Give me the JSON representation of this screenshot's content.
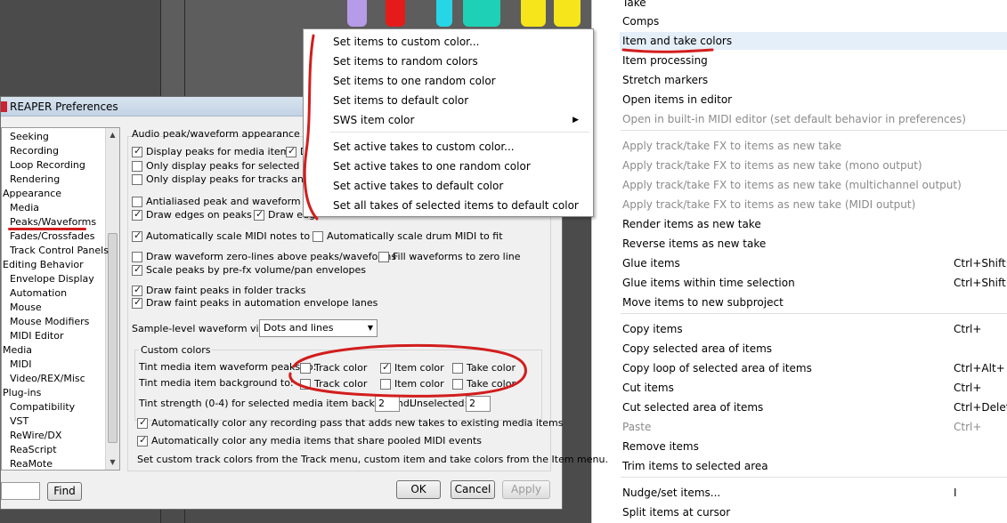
{
  "item_menu": {
    "items": [
      {
        "label": "Take",
        "disabled": false
      },
      {
        "label": "Comps",
        "disabled": false
      },
      {
        "label": "Item and take colors",
        "disabled": false,
        "highlighted": true
      },
      {
        "label": "Item processing",
        "disabled": false
      },
      {
        "label": "Stretch markers",
        "disabled": false
      },
      {
        "label": "Open items in editor",
        "disabled": false
      },
      {
        "label": "Open in built-in MIDI editor (set default behavior in preferences)",
        "disabled": true
      },
      {
        "label": "Apply track/take FX to items as new take",
        "disabled": true
      },
      {
        "label": "Apply track/take FX to items as new take (mono output)",
        "disabled": true
      },
      {
        "label": "Apply track/take FX to items as new take (multichannel output)",
        "disabled": true
      },
      {
        "label": "Apply track/take FX to items as new take (MIDI output)",
        "disabled": true
      },
      {
        "label": "Render items as new take",
        "disabled": false
      },
      {
        "label": "Reverse items as new take",
        "disabled": false
      },
      {
        "label": "Glue items",
        "disabled": false,
        "shortcut": "Ctrl+Shift+I"
      },
      {
        "label": "Glue items within time selection",
        "disabled": false,
        "shortcut": "Ctrl+Shift+"
      },
      {
        "label": "Move items to new subproject",
        "disabled": false
      },
      {
        "label": "Copy items",
        "disabled": false,
        "shortcut": "Ctrl+"
      },
      {
        "label": "Copy selected area of items",
        "disabled": false
      },
      {
        "label": "Copy loop of selected area of items",
        "disabled": false,
        "shortcut": "Ctrl+Alt+"
      },
      {
        "label": "Cut items",
        "disabled": false,
        "shortcut": "Ctrl+"
      },
      {
        "label": "Cut selected area of items",
        "disabled": false,
        "shortcut": "Ctrl+Delet"
      },
      {
        "label": "Paste",
        "disabled": true,
        "shortcut": "Ctrl+"
      },
      {
        "label": "Remove items",
        "disabled": false
      },
      {
        "label": "Trim items to selected area",
        "disabled": false
      },
      {
        "label": "Nudge/set items...",
        "disabled": false,
        "shortcut": "I"
      },
      {
        "label": "Split items at cursor",
        "disabled": false
      }
    ]
  },
  "color_menu": {
    "items": [
      {
        "label": "Set items to custom color..."
      },
      {
        "label": "Set items to random colors"
      },
      {
        "label": "Set items to one random color"
      },
      {
        "label": "Set items to default color"
      },
      {
        "label": "SWS item color",
        "submenu": true
      },
      {
        "label": "Set active takes to custom color..."
      },
      {
        "label": "Set active takes to one random color"
      },
      {
        "label": "Set active takes to default color"
      },
      {
        "label": "Set all takes of selected items to default color"
      }
    ],
    "submenu_arrow": "▶"
  },
  "prefs": {
    "title": "REAPER Preferences",
    "tree": [
      {
        "label": "Seeking",
        "level": 1
      },
      {
        "label": "Recording",
        "level": 1
      },
      {
        "label": "Loop Recording",
        "level": 1
      },
      {
        "label": "Rendering",
        "level": 1
      },
      {
        "label": "Appearance",
        "level": 0
      },
      {
        "label": "Media",
        "level": 1
      },
      {
        "label": "Peaks/Waveforms",
        "level": 1,
        "selected": true
      },
      {
        "label": "Fades/Crossfades",
        "level": 1
      },
      {
        "label": "Track Control Panels",
        "level": 1
      },
      {
        "label": "Editing Behavior",
        "level": 0
      },
      {
        "label": "Envelope Display",
        "level": 1
      },
      {
        "label": "Automation",
        "level": 1
      },
      {
        "label": "Mouse",
        "level": 1
      },
      {
        "label": "Mouse Modifiers",
        "level": 1
      },
      {
        "label": "MIDI Editor",
        "level": 1
      },
      {
        "label": "Media",
        "level": 0
      },
      {
        "label": "MIDI",
        "level": 1
      },
      {
        "label": "Video/REX/Misc",
        "level": 1
      },
      {
        "label": "Plug-ins",
        "level": 0
      },
      {
        "label": "Compatibility",
        "level": 1
      },
      {
        "label": "VST",
        "level": 1
      },
      {
        "label": "ReWire/DX",
        "level": 1
      },
      {
        "label": "ReaScript",
        "level": 1
      },
      {
        "label": "ReaMote",
        "level": 1
      }
    ],
    "section_title": "Audio peak/waveform appearance",
    "checkboxes": {
      "display_peaks": {
        "label": "Display peaks for media items",
        "checked": true
      },
      "display_peaks_right": {
        "label": "D",
        "checked": true
      },
      "only_selected_tracks": {
        "label": "Only display peaks for selected tracks",
        "checked": false
      },
      "only_tracks_items": {
        "label": "Only display peaks for tracks and item",
        "checked": false
      },
      "antialiased": {
        "label": "Antialiased peak and waveform drawi",
        "checked": false
      },
      "draw_edges_peaks": {
        "label": "Draw edges on peaks",
        "checked": true
      },
      "draw_edges_right": {
        "label": "Draw edg",
        "checked": true
      },
      "auto_scale_midi": {
        "label": "Automatically scale MIDI notes to fit",
        "checked": true
      },
      "auto_scale_drum": {
        "label": "Automatically scale drum MIDI to fit",
        "checked": false
      },
      "zero_lines": {
        "label": "Draw waveform zero-lines above peaks/waveforms",
        "checked": false
      },
      "fill_zero": {
        "label": "Fill waveforms to zero line",
        "checked": false
      },
      "scale_prefx": {
        "label": "Scale peaks by pre-fx volume/pan envelopes",
        "checked": true
      },
      "faint_folder": {
        "label": "Draw faint peaks in folder tracks",
        "checked": true
      },
      "faint_automation": {
        "label": "Draw faint peaks in automation envelope lanes",
        "checked": true
      },
      "auto_color_recording": {
        "label": "Automatically color any recording pass that adds new takes to existing media items",
        "checked": true
      },
      "auto_color_pooled": {
        "label": "Automatically color any media items that share pooled MIDI events",
        "checked": true
      }
    },
    "sample_level_label": "Sample-level waveform view:",
    "sample_level_value": "Dots and lines",
    "custom_colors": {
      "group_title": "Custom colors",
      "row1_label": "Tint media item waveform peaks to:",
      "row2_label": "Tint media item background to:",
      "row1": [
        {
          "label": "Track color",
          "checked": false
        },
        {
          "label": "Item color",
          "checked": true
        },
        {
          "label": "Take color",
          "checked": false
        }
      ],
      "row2": [
        {
          "label": "Track color",
          "checked": false
        },
        {
          "label": "Item color",
          "checked": false
        },
        {
          "label": "Take color",
          "checked": false
        }
      ],
      "tint_strength_label": "Tint strength (0-4) for selected media item background:",
      "tint_strength_value": "2",
      "unselected_label": "Unselected:",
      "unselected_value": "2"
    },
    "footer_hint": "Set custom track colors from the Track menu, custom item and take colors from the Item menu.",
    "buttons": {
      "find": "Find",
      "ok": "OK",
      "cancel": "Cancel",
      "apply": "Apply"
    }
  },
  "colors": {
    "annotation_red": "#d21d1d",
    "menu_highlight": "#e5eff9"
  }
}
